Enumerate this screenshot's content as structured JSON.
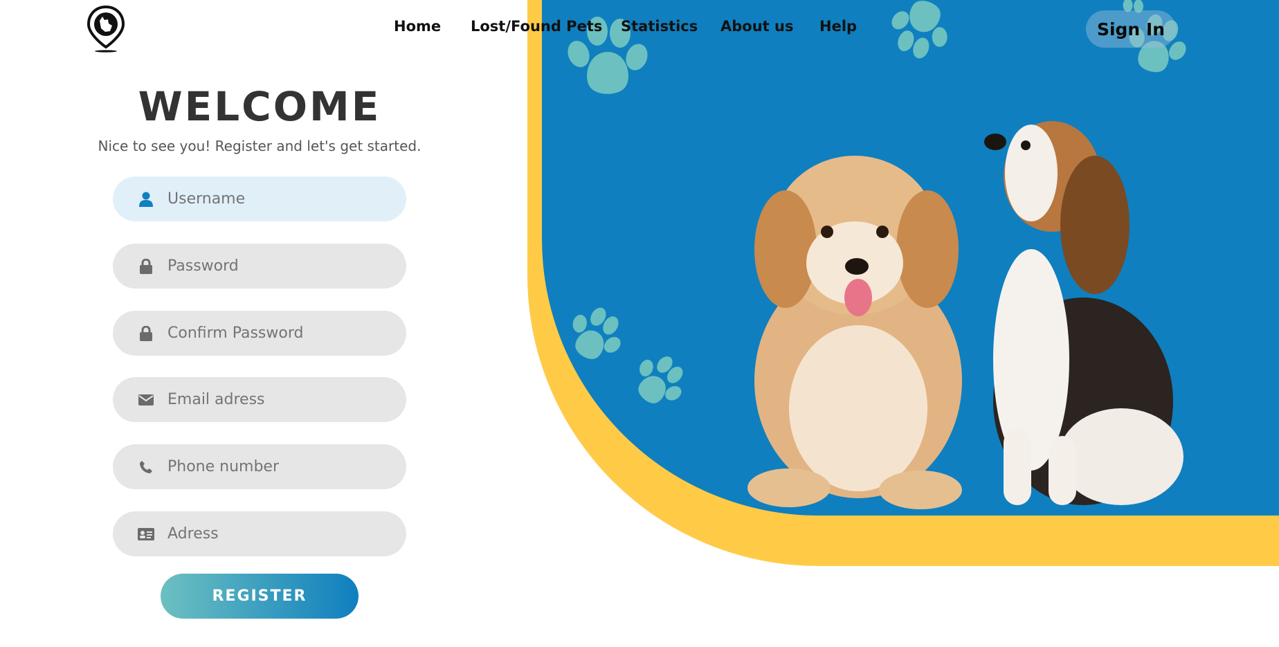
{
  "nav": {
    "home": "Home",
    "lost_found": "Lost/Found Pets",
    "statistics": "Statistics",
    "about": "About us",
    "help": "Help",
    "sign_in": "Sign In"
  },
  "form": {
    "title": "WELCOME",
    "subtitle": "Nice to see you! Register and let's get started.",
    "fields": [
      {
        "placeholder": "Username",
        "icon": "user-icon"
      },
      {
        "placeholder": "Password",
        "icon": "lock-icon"
      },
      {
        "placeholder": "Confirm Password",
        "icon": "lock-icon"
      },
      {
        "placeholder": "Email adress",
        "icon": "envelope-icon"
      },
      {
        "placeholder": "Phone number",
        "icon": "phone-icon"
      },
      {
        "placeholder": "Adress",
        "icon": "id-card-icon"
      }
    ],
    "register_label": "REGISTER"
  },
  "colors": {
    "hero_blue": "#0f7fbf",
    "hero_yellow": "#ffcb47",
    "paw": "#6cc0c0",
    "field_bg": "#e6e6e6",
    "field_active_bg": "#e1eff9",
    "button_gradient_start": "#6cc0c0",
    "button_gradient_end": "#0f7fbf"
  }
}
